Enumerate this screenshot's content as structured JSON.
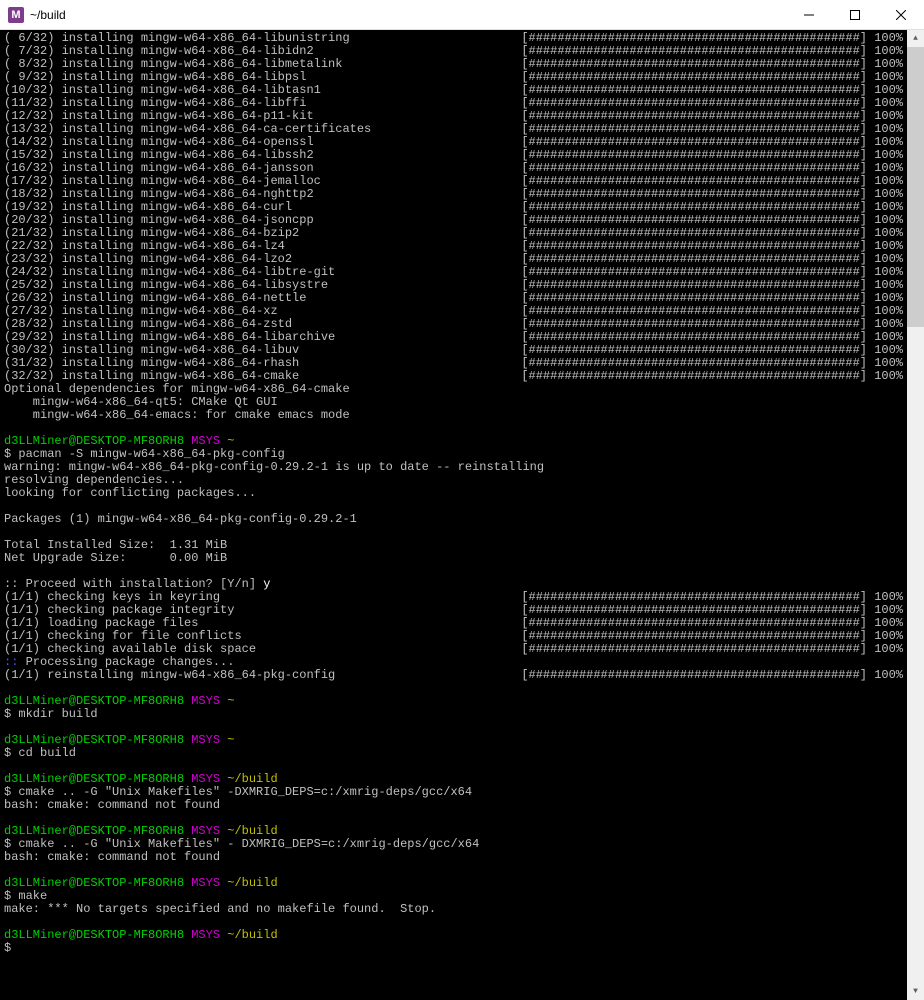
{
  "window": {
    "app_initial": "M",
    "title": "~/build"
  },
  "bar": "[##############################################]",
  "pct": "100%",
  "packages": [
    "( 6/32) installing mingw-w64-x86_64-libunistring",
    "( 7/32) installing mingw-w64-x86_64-libidn2",
    "( 8/32) installing mingw-w64-x86_64-libmetalink",
    "( 9/32) installing mingw-w64-x86_64-libpsl",
    "(10/32) installing mingw-w64-x86_64-libtasn1",
    "(11/32) installing mingw-w64-x86_64-libffi",
    "(12/32) installing mingw-w64-x86_64-p11-kit",
    "(13/32) installing mingw-w64-x86_64-ca-certificates",
    "(14/32) installing mingw-w64-x86_64-openssl",
    "(15/32) installing mingw-w64-x86_64-libssh2",
    "(16/32) installing mingw-w64-x86_64-jansson",
    "(17/32) installing mingw-w64-x86_64-jemalloc",
    "(18/32) installing mingw-w64-x86_64-nghttp2",
    "(19/32) installing mingw-w64-x86_64-curl",
    "(20/32) installing mingw-w64-x86_64-jsoncpp",
    "(21/32) installing mingw-w64-x86_64-bzip2",
    "(22/32) installing mingw-w64-x86_64-lz4",
    "(23/32) installing mingw-w64-x86_64-lzo2",
    "(24/32) installing mingw-w64-x86_64-libtre-git",
    "(25/32) installing mingw-w64-x86_64-libsystre",
    "(26/32) installing mingw-w64-x86_64-nettle",
    "(27/32) installing mingw-w64-x86_64-xz",
    "(28/32) installing mingw-w64-x86_64-zstd",
    "(29/32) installing mingw-w64-x86_64-libarchive",
    "(30/32) installing mingw-w64-x86_64-libuv",
    "(31/32) installing mingw-w64-x86_64-rhash",
    "(32/32) installing mingw-w64-x86_64-cmake"
  ],
  "opt_deps_header": "Optional dependencies for mingw-w64-x86_64-cmake",
  "opt_deps": [
    "    mingw-w64-x86_64-qt5: CMake Qt GUI",
    "    mingw-w64-x86_64-emacs: for cmake emacs mode"
  ],
  "prompt": {
    "user": "d3LLMiner@DESKTOP-MF8ORH8",
    "env": "MSYS",
    "tilde": "~",
    "builddir": "~/build"
  },
  "block1": {
    "cmd": "$ pacman -S mingw-w64-x86_64-pkg-config",
    "warn": "warning: mingw-w64-x86_64-pkg-config-0.29.2-1 is up to date -- reinstalling",
    "resolve": "resolving dependencies...",
    "conflict": "looking for conflicting packages...",
    "blank": "",
    "pkgs": "Packages (1) mingw-w64-x86_64-pkg-config-0.29.2-1",
    "total": "Total Installed Size:  1.31 MiB",
    "net": "Net Upgrade Size:      0.00 MiB",
    "proceed_pre": ":: Proceed with installation? [Y/n] ",
    "proceed_ans": "y",
    "checks": [
      "(1/1) checking keys in keyring",
      "(1/1) checking package integrity",
      "(1/1) loading package files",
      "(1/1) checking for file conflicts",
      "(1/1) checking available disk space"
    ],
    "processing_pre": "::",
    "processing": " Processing package changes...",
    "reinstall": "(1/1) reinstalling mingw-w64-x86_64-pkg-config"
  },
  "block_mkdir": "$ mkdir build",
  "block_cd": "$ cd build",
  "block_cmake1": {
    "cmd": "$ cmake .. -G \"Unix Makefiles\" -DXMRIG_DEPS=c:/xmrig-deps/gcc/x64",
    "err": "bash: cmake: command not found"
  },
  "block_cmake2": {
    "cmd": "$ cmake .. -G \"Unix Makefiles\" - DXMRIG_DEPS=c:/xmrig-deps/gcc/x64",
    "err": "bash: cmake: command not found"
  },
  "block_make": {
    "cmd": "$ make",
    "err": "make: *** No targets specified and no makefile found.  Stop."
  },
  "last_prompt": "$"
}
